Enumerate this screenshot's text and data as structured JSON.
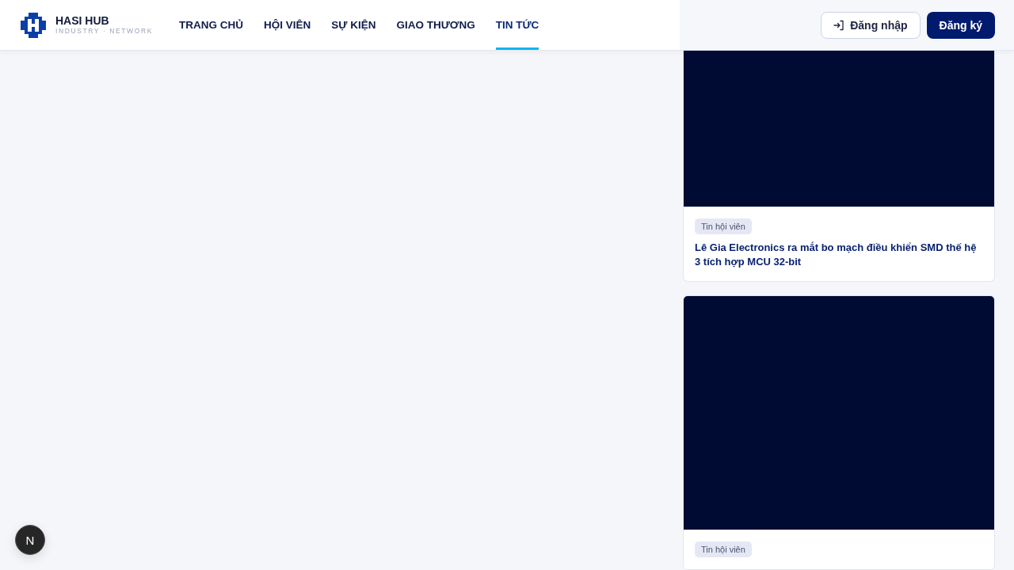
{
  "header": {
    "brand": "HASI HUB",
    "tagline": "INDUSTRY · NETWORK",
    "nav": [
      {
        "label": "TRANG CHỦ",
        "selected": false
      },
      {
        "label": "HỘI VIÊN",
        "selected": false
      },
      {
        "label": "SỰ KIỆN",
        "selected": false
      },
      {
        "label": "GIAO THƯƠNG",
        "selected": false
      },
      {
        "label": "TIN TỨC",
        "selected": true
      }
    ],
    "login": "Đăng nhập",
    "register": "Đăng ký"
  },
  "news": [
    {
      "tag": "Tin hội viên",
      "title": "Lê Gia Electronics ra mắt bo mạch điều khiển SMD thế hệ 3 tích hợp MCU 32-bit"
    },
    {
      "tag": "Tin hội viên"
    }
  ],
  "dev_badge": "N"
}
